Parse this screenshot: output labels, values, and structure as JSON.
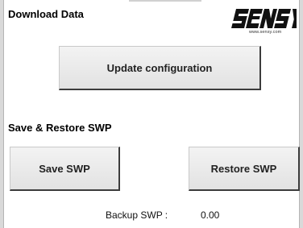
{
  "page": {
    "title": "Download Data",
    "section_title": "Save & Restore SWP"
  },
  "logo": {
    "text": "SENSY",
    "url": "www.sensy.com"
  },
  "buttons": {
    "update": "Update configuration",
    "save": "Save SWP",
    "restore": "Restore SWP"
  },
  "backup": {
    "label": "Backup SWP :",
    "value": "0.00"
  },
  "colors": {
    "background": "#ffffff",
    "button_face": "#e9e9e9",
    "button_shadow": "#3c3c3c"
  }
}
